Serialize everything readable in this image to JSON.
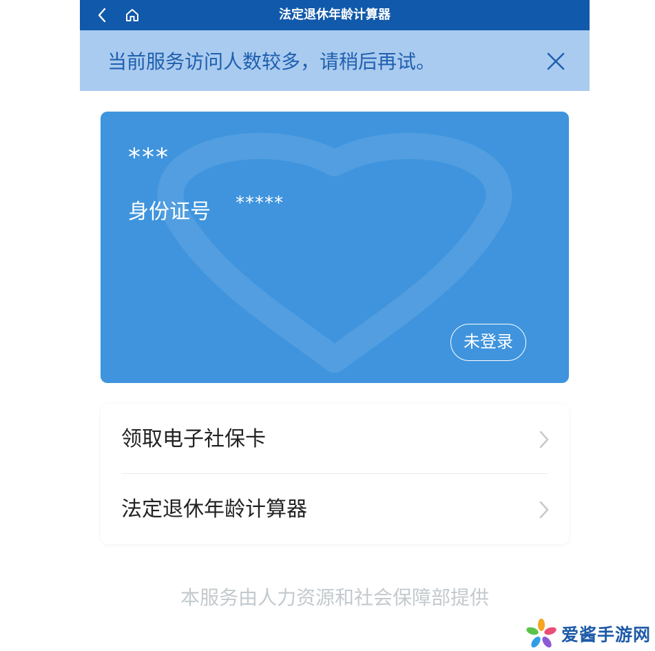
{
  "header": {
    "title": "法定退休年龄计算器"
  },
  "notice": {
    "text": "当前服务访问人数较多，请稍后再试。"
  },
  "card": {
    "name": "***",
    "id_label": "身份证号",
    "id_value": "*****",
    "login_label": "未登录"
  },
  "menu": {
    "items": [
      {
        "label": "领取电子社保卡"
      },
      {
        "label": "法定退休年龄计算器"
      }
    ]
  },
  "footer": {
    "text": "本服务由人力资源和社会保障部提供"
  },
  "watermark_brand": {
    "text": "爱酱手游网"
  },
  "colors": {
    "header": "#1159aa",
    "notice_bg": "#aacbf0",
    "notice_text": "#1f5fae",
    "card": "#3f94dd",
    "footer_text": "#c3c9cd"
  },
  "icons": {
    "back": "back-arrow-icon",
    "home": "home-icon",
    "close": "close-icon",
    "chevron": "chevron-right-icon"
  }
}
